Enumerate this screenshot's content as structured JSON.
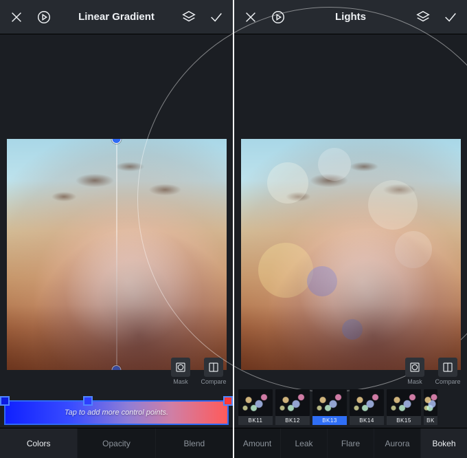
{
  "left": {
    "title": "Linear Gradient",
    "utils": {
      "mask": "Mask",
      "compare": "Compare"
    },
    "gradient_hint": "Tap to add more control points.",
    "tabs": [
      "Colors",
      "Opacity",
      "Blend"
    ],
    "active_tab": 0,
    "control_points": [
      {
        "position": 0.0,
        "color": "#1021ff"
      },
      {
        "position": 0.37,
        "color": "#2d3fff"
      },
      {
        "position": 1.0,
        "color": "#ff3a3a"
      }
    ]
  },
  "right": {
    "title": "Lights",
    "utils": {
      "mask": "Mask",
      "compare": "Compare"
    },
    "thumbs": [
      "BK11",
      "BK12",
      "BK13",
      "BK14",
      "BK15",
      "BK"
    ],
    "active_thumb": 2,
    "tabs": [
      "Amount",
      "Leak",
      "Flare",
      "Aurora",
      "Bokeh"
    ],
    "active_tab": 4
  }
}
